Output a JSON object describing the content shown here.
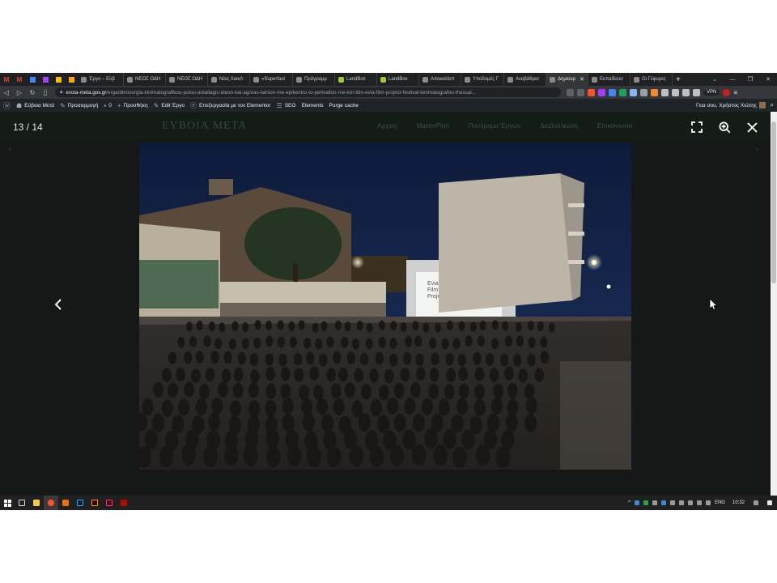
{
  "browser": {
    "tabs": [
      {
        "label": "Έργο – Εύβ",
        "color": "#8a8a8a",
        "active": false
      },
      {
        "label": "ΝΕΟΣ ΟΔΗ",
        "color": "#8a8a8a",
        "active": false
      },
      {
        "label": "ΝΕΟΣ ΟΔΗ",
        "color": "#8a8a8a",
        "active": false
      },
      {
        "label": "Νέες διακΛ",
        "color": "#8a8a8a",
        "active": false
      },
      {
        "label": "«Superfast",
        "color": "#8a8a8a",
        "active": false
      },
      {
        "label": "Πρόγραμμ",
        "color": "#8a8a8a",
        "active": false
      },
      {
        "label": "LandBox",
        "color": "#a4c639",
        "active": false
      },
      {
        "label": "LandBox",
        "color": "#a4c639",
        "active": false
      },
      {
        "label": "Αποκατάστ",
        "color": "#8a8a8a",
        "active": false
      },
      {
        "label": "Υποδομές Γ",
        "color": "#8a8a8a",
        "active": false
      },
      {
        "label": "Αναβάθμισ",
        "color": "#8a8a8a",
        "active": false
      },
      {
        "label": "Δημιουρ",
        "color": "#8a8a8a",
        "active": true
      },
      {
        "label": "Εκπαίδευσ",
        "color": "#8a8a8a",
        "active": false
      },
      {
        "label": "Οι Γέφυρες",
        "color": "#8a8a8a",
        "active": false
      }
    ],
    "new_tab": "+",
    "url_host": "evoia-meta.gov.gr",
    "url_path": "/erga/dimiourgia-kinimatografikou-polou-antallagis-ideon-kai-agoras-tainion-me-epikentro-to-perivallon-me-ton-titlo-evia-film-project-festival-kinimatografou-thessal...",
    "vpn_label": "VPN"
  },
  "wp_admin_bar": {
    "site_name": "Εύβοια Μετά",
    "customize": "Προσαρμογή",
    "comments_count": "0",
    "new_label": "Προσθήκη",
    "edit_label": "Edit Έργο",
    "elementor_label": "Επεξεργασία με τον Elementor",
    "seo_label": "SEO",
    "elements_label": "Elements",
    "purge_label": "Purge cache",
    "greeting": "Γεια σου, Χρήστος Χιώτης"
  },
  "site": {
    "logo_text": "ΕΥΒΟΙΑ ΜΕΤΑ",
    "menu": [
      "Αρχική",
      "MasterPlan",
      "Πανόραμα Έργων",
      "Διαβούλευση",
      "Επικοινωνία"
    ]
  },
  "lightbox": {
    "counter": "13 / 14",
    "photo_screen_text": [
      "Evia",
      "Film",
      "Project"
    ]
  },
  "taskbar": {
    "lang": "ENG",
    "time": "10:32"
  }
}
